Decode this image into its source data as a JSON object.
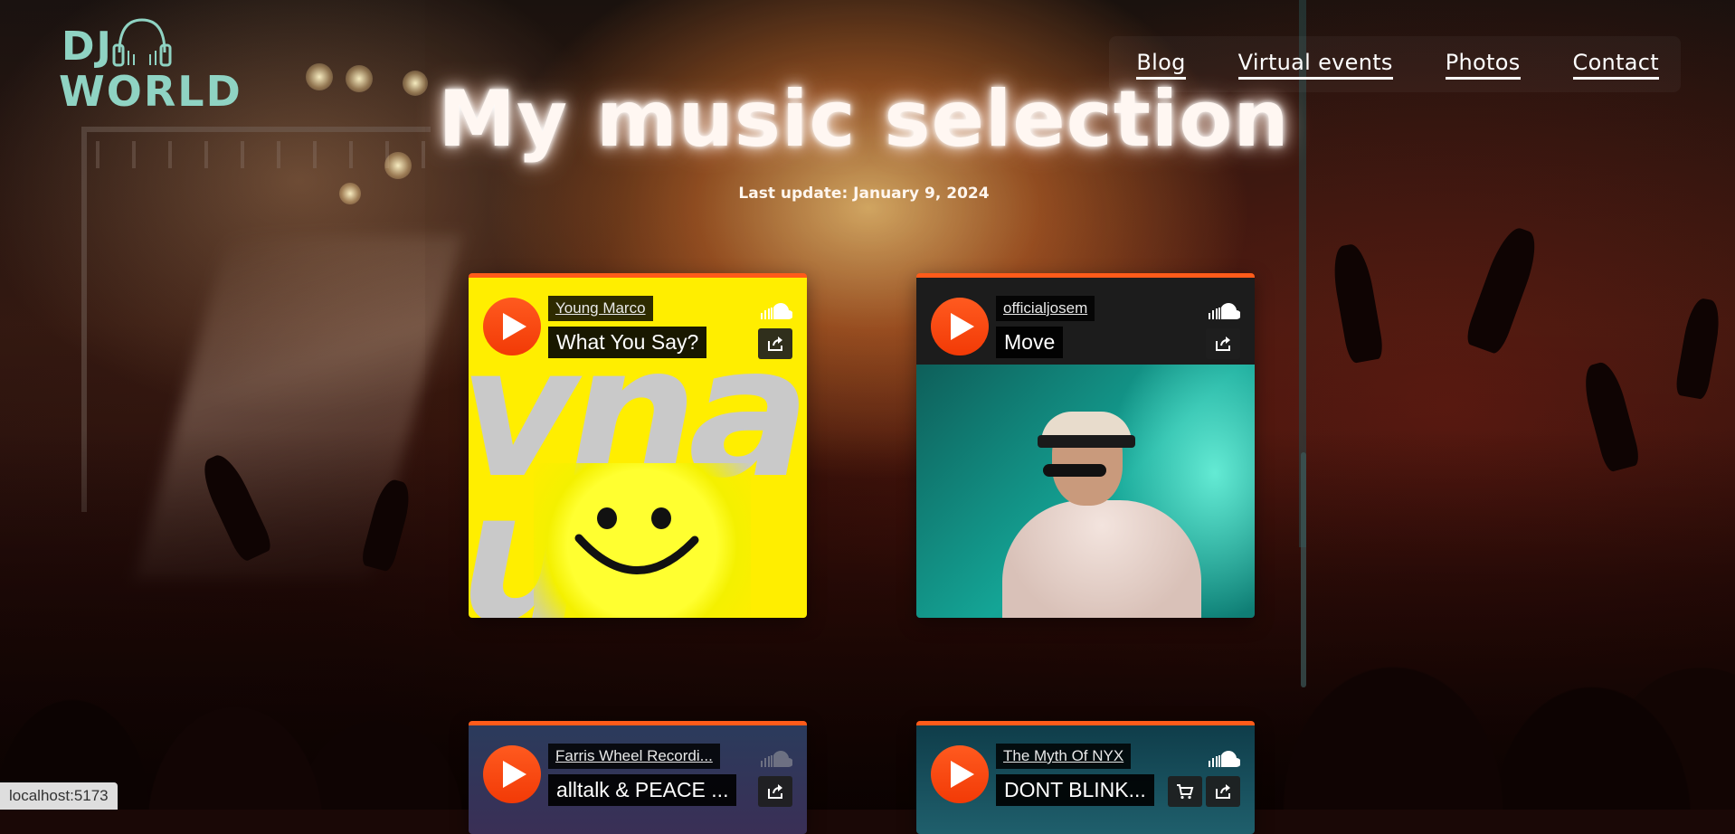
{
  "logo": {
    "line1": "DJ",
    "line2": "WORLD"
  },
  "nav": {
    "items": [
      {
        "label": "Blog"
      },
      {
        "label": "Virtual events"
      },
      {
        "label": "Photos"
      },
      {
        "label": "Contact"
      }
    ]
  },
  "main": {
    "title": "My music selection",
    "subtitle": "Last update: January 9, 2024"
  },
  "tracks": [
    {
      "artist": "Young Marco",
      "title": "What You Say?"
    },
    {
      "artist": "officialjosem",
      "title": "Move"
    },
    {
      "artist": "Farris Wheel Recordi...",
      "title": "alltalk & PEACE ..."
    },
    {
      "artist": "The Myth Of NYX",
      "title": "DONT BLINK..."
    }
  ],
  "status_bar": {
    "url": "localhost:5173"
  },
  "colors": {
    "accent": "#ff5b1a",
    "logo": "#8fd3c3"
  }
}
